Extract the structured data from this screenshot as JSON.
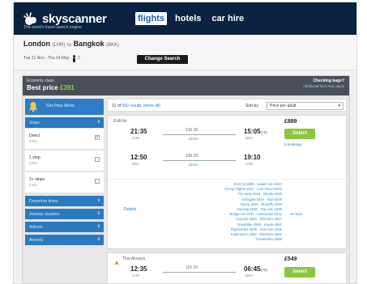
{
  "header": {
    "brand": "skyscanner",
    "tagline": "The world's travel search engine",
    "nav": [
      {
        "label": "flights",
        "active": true
      },
      {
        "label": "hotels",
        "active": false
      },
      {
        "label": "car hire",
        "active": false
      }
    ]
  },
  "route": {
    "origin": "London",
    "origin_code": "(LHR)",
    "connector": "to",
    "destination": "Bangkok",
    "destination_code": "(BKK)",
    "dates": "Tue 21 Nov - Thu 14 May",
    "passengers": "1",
    "change_label": "Change Search"
  },
  "summary": {
    "cabin": "Economy class",
    "best_label": "Best price",
    "best_amount": "£391",
    "bags_title": "Checking bags?",
    "bags_link": "Additional fees may apply"
  },
  "sidebar": {
    "alerts_label": "Get Price Alerts",
    "filters": [
      {
        "label": "Stops",
        "chevron": "∧"
      },
      {
        "label": "Departure times",
        "chevron": "∨"
      },
      {
        "label": "Journey duration",
        "chevron": "∨"
      },
      {
        "label": "Airlines",
        "chevron": "∨"
      },
      {
        "label": "Airports",
        "chevron": "∨"
      }
    ],
    "stops": [
      {
        "label": "Direct",
        "price": "£391",
        "checked": true
      },
      {
        "label": "1 stop",
        "price": "£352",
        "checked": false
      },
      {
        "label": "2+ stops",
        "price": "£322",
        "checked": false
      }
    ]
  },
  "results": {
    "count_prefix": "12 of",
    "count_link": "590 results (show all)",
    "sort_label": "Sort by",
    "sort_value": "Price per adult",
    "cards": [
      {
        "carrier": "EVA Air",
        "price": "£889",
        "select_label": "Select",
        "sub_link": "5 bookings",
        "details_label": "Details",
        "more_label": "+5 more",
        "legs": [
          {
            "dep": "21:35",
            "dep_code": "LHR",
            "duration": "13h 30",
            "stops": "Direct",
            "arr": "15:05",
            "arr_sup": "(+1)",
            "arr_code": "BKK"
          },
          {
            "dep": "12:50",
            "dep_code": "BKK",
            "duration": "13h 20",
            "stops": "Direct",
            "arr": "19:10",
            "arr_sup": "",
            "arr_code": "LHR"
          }
        ],
        "agents": [
          "EVA Air £889 · evaair.com £910",
          "Cheap Flights £912 · Last Travel £915",
          "Fly Away £918 · Opodo £920",
          "Gotogate £924 · Kiwi £925",
          "Mytrip £928 · Bravofly £930",
          "travelup £935 · Trip.com £938",
          "Budget Air £940 · Lastminute £942",
          "Expedia £945 · eDreams £947",
          "Travel2Be £950 · Kayak £952",
          "Flightcentre £955 · Kiwi.com £958",
          "Supersaver £960 · ebookers £962",
          "Traveltrolley £965"
        ]
      },
      {
        "carrier": "Thai Airways",
        "price": "£549",
        "select_label": "Select",
        "legs": [
          {
            "dep": "12:35",
            "dep_code": "LHR",
            "duration": "11h 10",
            "stops": "",
            "arr": "06:45",
            "arr_sup": "(+1)",
            "arr_code": "BKK"
          }
        ]
      }
    ]
  },
  "colors": {
    "header_bg": "#0b2341",
    "accent_blue": "#2e7bc6",
    "select_green": "#8cc63e",
    "price_green": "#8ad33a"
  },
  "icons": {
    "logo": "cloud-sun-icon",
    "bell": "bell-icon",
    "person": "person-icon",
    "airline": "airline-logo-icon"
  }
}
